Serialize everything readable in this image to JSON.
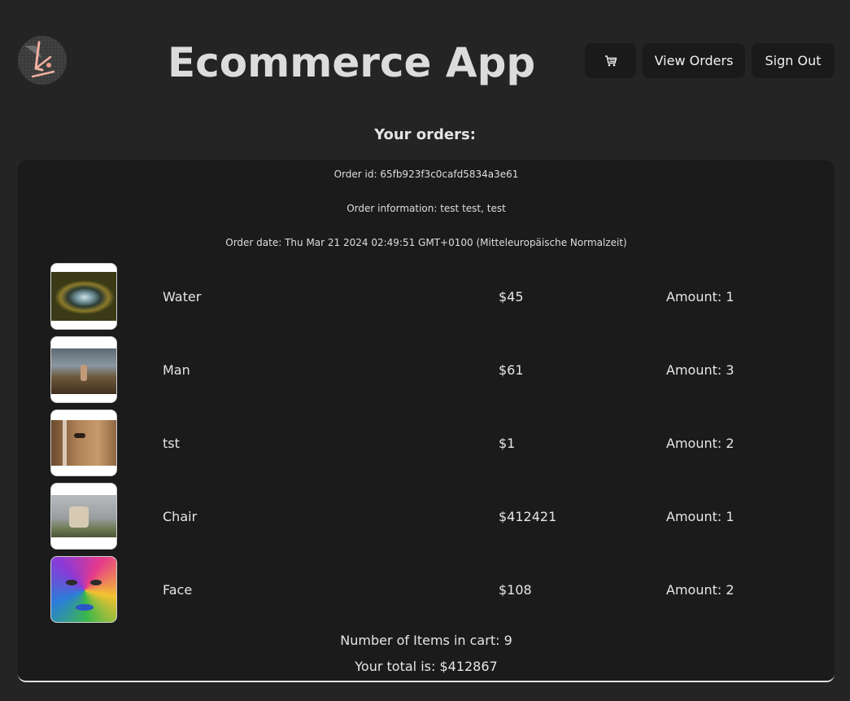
{
  "header": {
    "title": "Ecommerce App",
    "nav": {
      "cart_icon": "shopping-cart-icon",
      "view_orders_label": "View Orders",
      "sign_out_label": "Sign Out"
    }
  },
  "orders": {
    "heading": "Your orders:",
    "order": {
      "id_text": "Order id: 65fb923f3c0cafd5834a3e61",
      "info_text": "Order information: test test, test",
      "date_text": "Order date: Thu Mar 21 2024 02:49:51 GMT+0100 (Mitteleuropäische Normalzeit)",
      "items": [
        {
          "name": "Water",
          "price": "$45",
          "amount": "Amount: 1"
        },
        {
          "name": "Man",
          "price": "$61",
          "amount": "Amount: 3"
        },
        {
          "name": "tst",
          "price": "$1",
          "amount": "Amount: 2"
        },
        {
          "name": "Chair",
          "price": "$412421",
          "amount": "Amount: 1"
        },
        {
          "name": "Face",
          "price": "$108",
          "amount": "Amount: 2"
        }
      ],
      "items_count_text": "Number of Items in cart: 9",
      "total_text": "Your total is: $412867"
    }
  },
  "colors": {
    "background": "#242424",
    "card": "#1b1b1b",
    "button": "#1a1a1a",
    "accent_logo": "#e79c8a"
  }
}
